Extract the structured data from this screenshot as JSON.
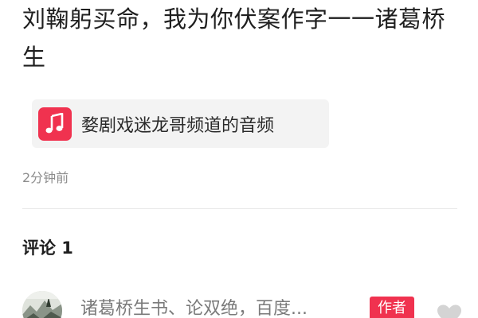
{
  "article": {
    "title": "刘鞠躬买命，我为你伏案作字一一诸葛桥生"
  },
  "audio": {
    "icon": "music-note-icon",
    "label": "婺剧戏迷龙哥频道的音频",
    "accent_color": "#f0324f"
  },
  "meta": {
    "timestamp": "2分钟前"
  },
  "comments": {
    "heading": "评论 1",
    "items": [
      {
        "text": "诸葛桥生书、论双绝，百度...",
        "badge": "作者",
        "avatar": "avatar-image",
        "like_icon": "heart-icon"
      }
    ]
  }
}
